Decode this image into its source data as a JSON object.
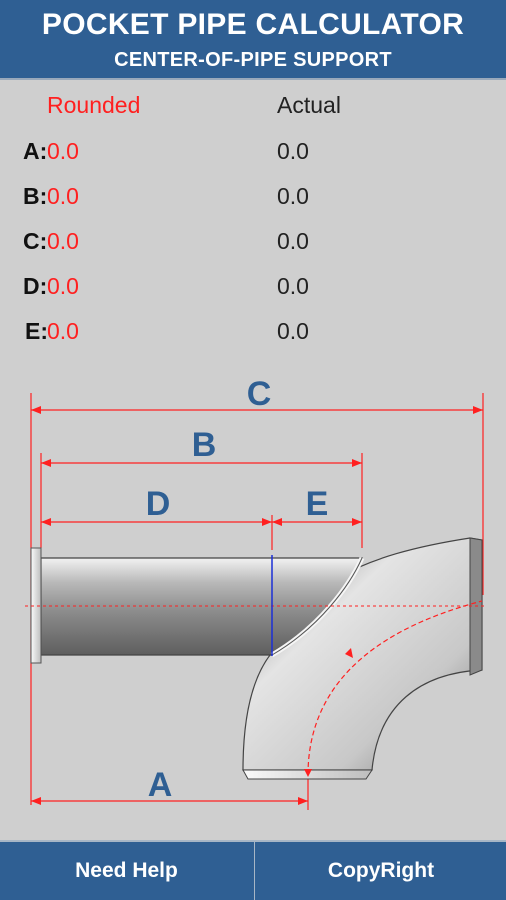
{
  "header": {
    "title": "POCKET PIPE CALCULATOR",
    "subtitle": "CENTER-OF-PIPE SUPPORT"
  },
  "columns": {
    "rounded": "Rounded",
    "actual": "Actual"
  },
  "rows": [
    {
      "label": "A:",
      "rounded": "0.0",
      "actual": "0.0"
    },
    {
      "label": "B:",
      "rounded": "0.0",
      "actual": "0.0"
    },
    {
      "label": "C:",
      "rounded": "0.0",
      "actual": "0.0"
    },
    {
      "label": "D:",
      "rounded": "0.0",
      "actual": "0.0"
    },
    {
      "label": "E:",
      "rounded": "0.0",
      "actual": "0.0"
    }
  ],
  "diagram": {
    "labels": {
      "a": "A",
      "b": "B",
      "c": "C",
      "d": "D",
      "e": "E"
    }
  },
  "footer": {
    "help_label": "Need Help",
    "copyright_label": "CopyRight"
  },
  "colors": {
    "header_bg": "#2f5f93",
    "rounded_value": "#ff2020",
    "dimension_line": "#ff2020",
    "dimension_letter": "#2f5f93"
  }
}
